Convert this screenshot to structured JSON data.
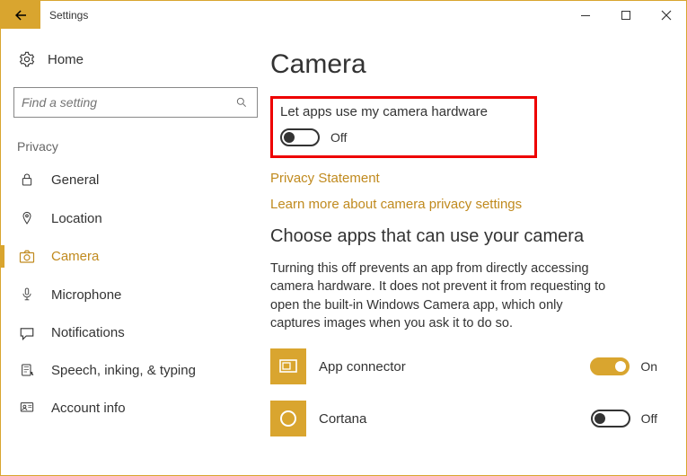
{
  "titlebar": {
    "title": "Settings"
  },
  "sidebar": {
    "home_label": "Home",
    "search_placeholder": "Find a setting",
    "section_label": "Privacy",
    "items": [
      {
        "label": "General"
      },
      {
        "label": "Location"
      },
      {
        "label": "Camera"
      },
      {
        "label": "Microphone"
      },
      {
        "label": "Notifications"
      },
      {
        "label": "Speech, inking, & typing"
      },
      {
        "label": "Account info"
      }
    ]
  },
  "main": {
    "page_title": "Camera",
    "permission_label": "Let apps use my camera hardware",
    "permission_state": "Off",
    "link_privacy": "Privacy Statement",
    "link_learn": "Learn more about camera privacy settings",
    "choose_heading": "Choose apps that can use your camera",
    "choose_desc": "Turning this off prevents an app from directly accessing camera hardware. It does not prevent it from requesting to open the built-in Windows Camera app, which only captures images when you ask it to do so.",
    "apps": [
      {
        "name": "App connector",
        "state": "On"
      },
      {
        "name": "Cortana",
        "state": "Off"
      }
    ]
  }
}
